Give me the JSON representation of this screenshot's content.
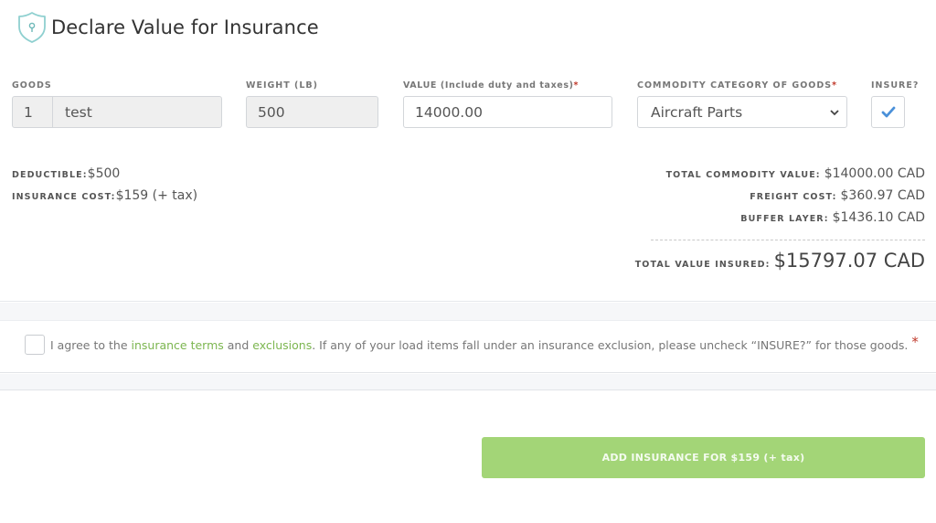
{
  "header": {
    "title": "Declare Value for Insurance",
    "icon": "shield-lock-icon"
  },
  "form": {
    "goods": {
      "label": "GOODS",
      "quantity": "1",
      "name": "test"
    },
    "weight": {
      "label": "WEIGHT (LB)",
      "value": "500"
    },
    "value": {
      "label": "VALUE (Include duty and taxes)",
      "required_mark": "*",
      "value": "14000.00"
    },
    "commodity": {
      "label": "COMMODITY CATEGORY OF GOODS",
      "required_mark": "*",
      "selected": "Aircraft Parts"
    },
    "insure": {
      "label": "INSURE?",
      "checked": true
    }
  },
  "summary": {
    "deductible_label": "DEDUCTIBLE:",
    "deductible_value": "$500",
    "insurance_cost_label": "INSURANCE COST:",
    "insurance_cost_value": "$159 (+ tax)",
    "total_commodity_label": "TOTAL COMMODITY VALUE:",
    "total_commodity_value": "$14000.00 CAD",
    "freight_cost_label": "FREIGHT COST:",
    "freight_cost_value": "$360.97 CAD",
    "buffer_layer_label": "BUFFER LAYER:",
    "buffer_layer_value": "$1436.10 CAD",
    "total_insured_label": "TOTAL VALUE INSURED:",
    "total_insured_value": "$15797.07 CAD"
  },
  "terms": {
    "prefix": "I agree to the ",
    "link1": "insurance terms",
    "middle": " and ",
    "link2": "exclusions",
    "suffix": ". If any of your load items fall under an insurance exclusion, please uncheck “INSURE?” for those goods.",
    "required_mark": "*",
    "checked": false
  },
  "actions": {
    "add_insurance_label": "ADD INSURANCE FOR $159 (+ tax)"
  },
  "colors": {
    "accent_green": "#a3d577",
    "link_green": "#7cb650",
    "check_blue": "#4a90d9",
    "shield_teal": "#8fd0d0",
    "required_red": "#c0392b"
  }
}
